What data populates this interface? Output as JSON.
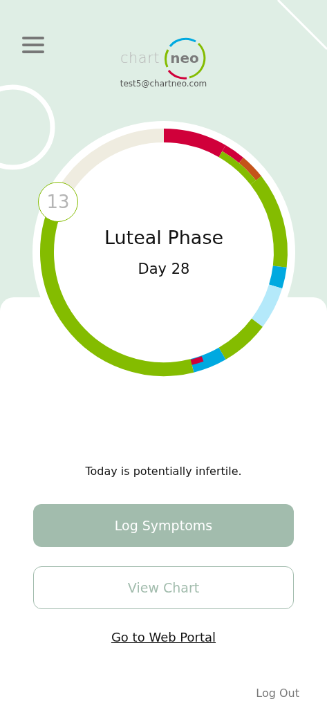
{
  "header": {
    "logo": {
      "part_1": "chart",
      "part_2": "neo"
    },
    "email": "test5@chartneo.com"
  },
  "cycle": {
    "day_badge": "13",
    "phase": "Luteal Phase",
    "day": "Day 28"
  },
  "status": "Today is potentially infertile.",
  "buttons": [
    {
      "label": "Log Symptoms",
      "kind": "primary"
    },
    {
      "label": "View Chart",
      "kind": "outline"
    }
  ],
  "link": "Go to Web Portal",
  "logout": "Log Out"
}
